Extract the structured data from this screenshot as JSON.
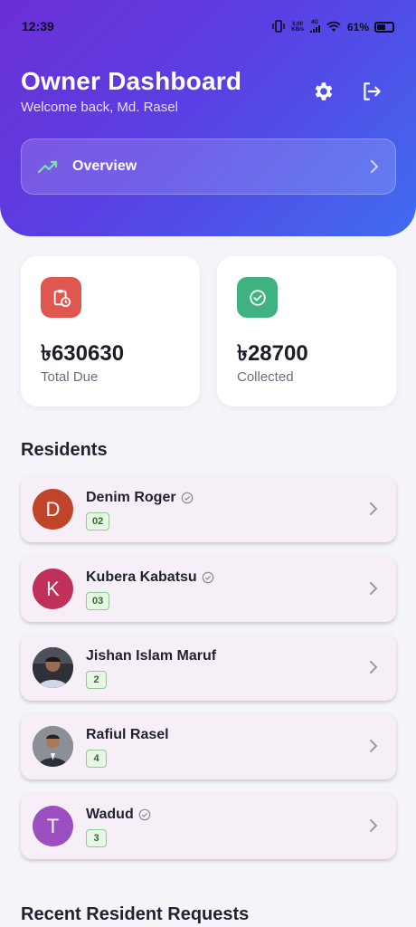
{
  "status": {
    "time": "12:39",
    "net_speed_top": "0.00",
    "net_speed_bottom": "KB/s",
    "network": "4G",
    "battery": "61%"
  },
  "header": {
    "title": "Owner Dashboard",
    "subtitle": "Welcome back, Md. Rasel",
    "overview_label": "Overview"
  },
  "stats": [
    {
      "value": "৳630630",
      "label": "Total Due",
      "color": "#e0574f"
    },
    {
      "value": "৳28700",
      "label": "Collected",
      "color": "#3fb27f"
    }
  ],
  "residents_title": "Residents",
  "residents": [
    {
      "name": "Denim Roger",
      "initial": "D",
      "badge": "02",
      "verified": true,
      "avatar_color": "#c0442a"
    },
    {
      "name": "Kubera Kabatsu",
      "initial": "K",
      "badge": "03",
      "verified": true,
      "avatar_color": "#c0305a"
    },
    {
      "name": "Jishan Islam Maruf",
      "initial": "",
      "badge": "2",
      "verified": false,
      "avatar_color": "#3a3a3a"
    },
    {
      "name": "Rafiul Rasel",
      "initial": "",
      "badge": "4",
      "verified": false,
      "avatar_color": "#4a4f5a"
    },
    {
      "name": "Wadud",
      "initial": "T",
      "badge": "3",
      "verified": true,
      "avatar_color": "#9b4fc0"
    }
  ],
  "requests_title": "Recent Resident Requests"
}
